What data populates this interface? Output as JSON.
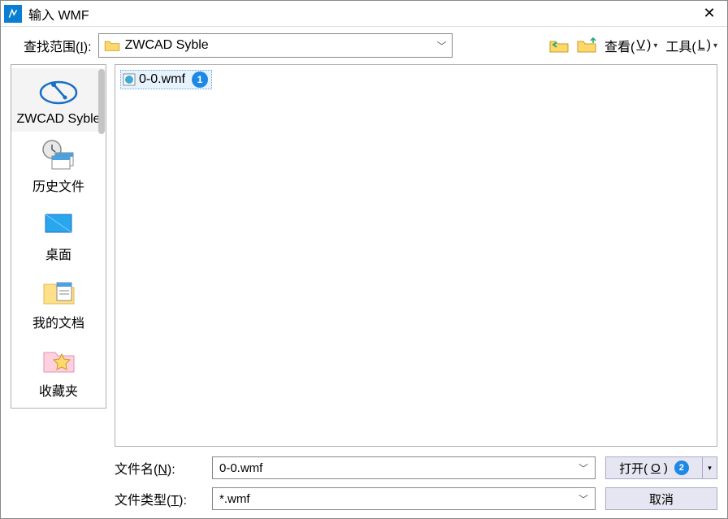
{
  "title": "输入 WMF",
  "toprow": {
    "label_pre": "查找范围(",
    "label_ul": "I",
    "label_post": "):",
    "folder": "ZWCAD Syble",
    "view_pre": "查看(",
    "view_ul": "V",
    "view_post": ")",
    "tools_pre": "工具(",
    "tools_ul": "L",
    "tools_post": ")"
  },
  "sidebar": {
    "items": [
      {
        "label": "ZWCAD Syble"
      },
      {
        "label": "历史文件"
      },
      {
        "label": "桌面"
      },
      {
        "label": "我的文档"
      },
      {
        "label": "收藏夹"
      }
    ]
  },
  "files": {
    "item0": "0-0.wmf",
    "callout0": "1"
  },
  "bottom": {
    "name_label_pre": "文件名(",
    "name_label_ul": "N",
    "name_label_post": "):",
    "name_value": "0-0.wmf",
    "type_label_pre": "文件类型(",
    "type_label_ul": "T",
    "type_label_post": "):",
    "type_value": "*.wmf",
    "open_pre": "打开(",
    "open_ul": "O",
    "open_post": ")",
    "open_callout": "2",
    "cancel": "取消"
  }
}
